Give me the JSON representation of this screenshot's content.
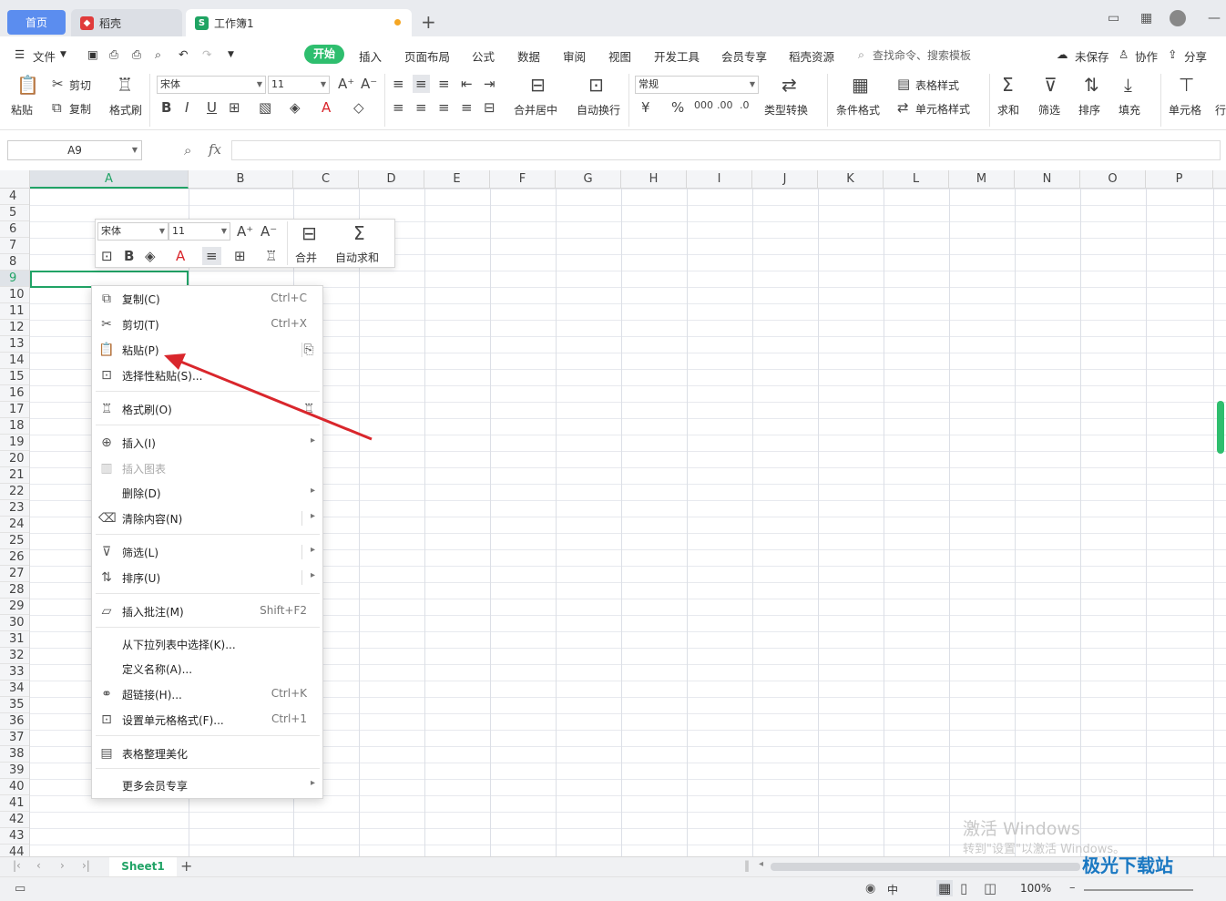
{
  "titlebar": {
    "tabs": [
      {
        "label": "首页"
      },
      {
        "label": "稻壳"
      },
      {
        "label": "工作簿1"
      }
    ],
    "new_tab": "+"
  },
  "menubar": {
    "file": "文件",
    "items": [
      "开始",
      "插入",
      "页面布局",
      "公式",
      "数据",
      "审阅",
      "视图",
      "开发工具",
      "会员专享",
      "稻壳资源"
    ],
    "search_placeholder": "查找命令、搜索模板",
    "unsaved": "未保存",
    "collab": "协作",
    "share": "分享"
  },
  "ribbon": {
    "paste": "粘贴",
    "cut": "剪切",
    "copy": "复制",
    "format_painter": "格式刷",
    "font_name": "宋体",
    "font_size": "11",
    "merge_center": "合并居中",
    "wrap": "自动换行",
    "number_format": "常规",
    "type_convert": "类型转换",
    "cond_format": "条件格式",
    "table_style": "表格样式",
    "cell_style": "单元格样式",
    "sum": "求和",
    "filter": "筛选",
    "sort": "排序",
    "fill": "填充",
    "cell": "单元格",
    "row_col": "行"
  },
  "formula_bar": {
    "name_box": "A9",
    "fx": "fx"
  },
  "grid": {
    "columns": [
      "A",
      "B",
      "C",
      "D",
      "E",
      "F",
      "G",
      "H",
      "I",
      "J",
      "K",
      "L",
      "M",
      "N",
      "O",
      "P"
    ],
    "rows": [
      "4",
      "5",
      "6",
      "7",
      "8",
      "9",
      "10",
      "11",
      "12",
      "13",
      "14",
      "15",
      "16",
      "17",
      "18",
      "19",
      "20",
      "21",
      "22",
      "23",
      "24",
      "25",
      "26",
      "27",
      "28",
      "29",
      "30",
      "31",
      "32",
      "33",
      "34",
      "35",
      "36",
      "37",
      "38",
      "39",
      "40",
      "41",
      "42",
      "43",
      "44"
    ]
  },
  "mini_toolbar": {
    "font": "宋体",
    "size": "11",
    "merge": "合并",
    "autosum": "自动求和"
  },
  "context_menu": [
    {
      "label": "复制(C)",
      "shortcut": "Ctrl+C",
      "icon": "copy-icon"
    },
    {
      "label": "剪切(T)",
      "shortcut": "Ctrl+X",
      "icon": "scissors-icon"
    },
    {
      "label": "粘贴(P)",
      "shortcut": "",
      "icon": "paste-icon"
    },
    {
      "label": "选择性粘贴(S)...",
      "shortcut": "",
      "icon": "paste-special-icon"
    },
    {
      "label": "格式刷(O)",
      "shortcut": "",
      "icon": "brush-icon"
    },
    {
      "label": "插入(I)",
      "shortcut": "",
      "icon": "insert-icon"
    },
    {
      "label": "插入图表",
      "shortcut": "",
      "icon": "chart-icon"
    },
    {
      "label": "删除(D)",
      "shortcut": "",
      "icon": ""
    },
    {
      "label": "清除内容(N)",
      "shortcut": "",
      "icon": "eraser-icon"
    },
    {
      "label": "筛选(L)",
      "shortcut": "",
      "icon": "filter-icon"
    },
    {
      "label": "排序(U)",
      "shortcut": "",
      "icon": "sort-icon"
    },
    {
      "label": "插入批注(M)",
      "shortcut": "Shift+F2",
      "icon": "comment-icon"
    },
    {
      "label": "从下拉列表中选择(K)...",
      "shortcut": "",
      "icon": ""
    },
    {
      "label": "定义名称(A)...",
      "shortcut": "",
      "icon": ""
    },
    {
      "label": "超链接(H)...",
      "shortcut": "Ctrl+K",
      "icon": "link-icon"
    },
    {
      "label": "设置单元格格式(F)...",
      "shortcut": "Ctrl+1",
      "icon": "format-cell-icon"
    },
    {
      "label": "表格整理美化",
      "shortcut": "",
      "icon": "beautify-icon"
    },
    {
      "label": "更多会员专享",
      "shortcut": "",
      "icon": ""
    }
  ],
  "sheet": {
    "name": "Sheet1",
    "add": "+"
  },
  "status": {
    "zoom": "100%",
    "input_lang": "中"
  },
  "watermark": {
    "line1": "激活 Windows",
    "line2": "转到\"设置\"以激活 Windows。",
    "site": "极光下载站"
  },
  "colors": {
    "accent": "#2ebe6e",
    "tab_home": "#5b8def",
    "selection": "#21a366",
    "arrow": "#d9262c"
  }
}
